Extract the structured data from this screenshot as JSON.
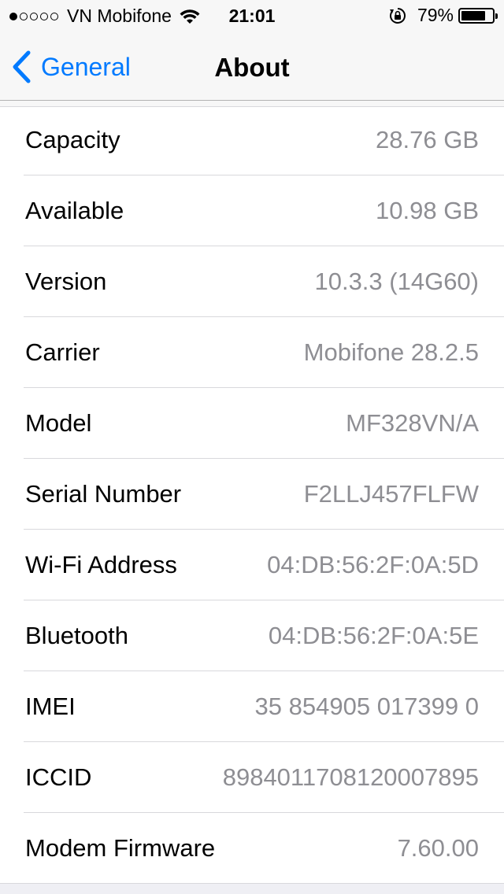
{
  "status_bar": {
    "carrier": "VN Mobifone",
    "signal_bars_filled": 1,
    "signal_bars_total": 5,
    "time": "21:01",
    "battery_percent": "79%",
    "battery_level": 0.79
  },
  "nav": {
    "back_label": "General",
    "title": "About"
  },
  "rows": [
    {
      "label": "Capacity",
      "value": "28.76 GB"
    },
    {
      "label": "Available",
      "value": "10.98 GB"
    },
    {
      "label": "Version",
      "value": "10.3.3 (14G60)"
    },
    {
      "label": "Carrier",
      "value": "Mobifone 28.2.5"
    },
    {
      "label": "Model",
      "value": "MF328VN/A"
    },
    {
      "label": "Serial Number",
      "value": "F2LLJ457FLFW"
    },
    {
      "label": "Wi-Fi Address",
      "value": "04:DB:56:2F:0A:5D"
    },
    {
      "label": "Bluetooth",
      "value": "04:DB:56:2F:0A:5E"
    },
    {
      "label": "IMEI",
      "value": "35 854905 017399 0"
    },
    {
      "label": "ICCID",
      "value": "8984011708120007895"
    },
    {
      "label": "Modem Firmware",
      "value": "7.60.00"
    }
  ],
  "colors": {
    "accent": "#007aff",
    "secondary_text": "#8e8e93",
    "background": "#efeff4"
  },
  "icons": [
    "wifi-icon",
    "rotation-lock-icon",
    "battery-icon",
    "chevron-left-icon"
  ]
}
